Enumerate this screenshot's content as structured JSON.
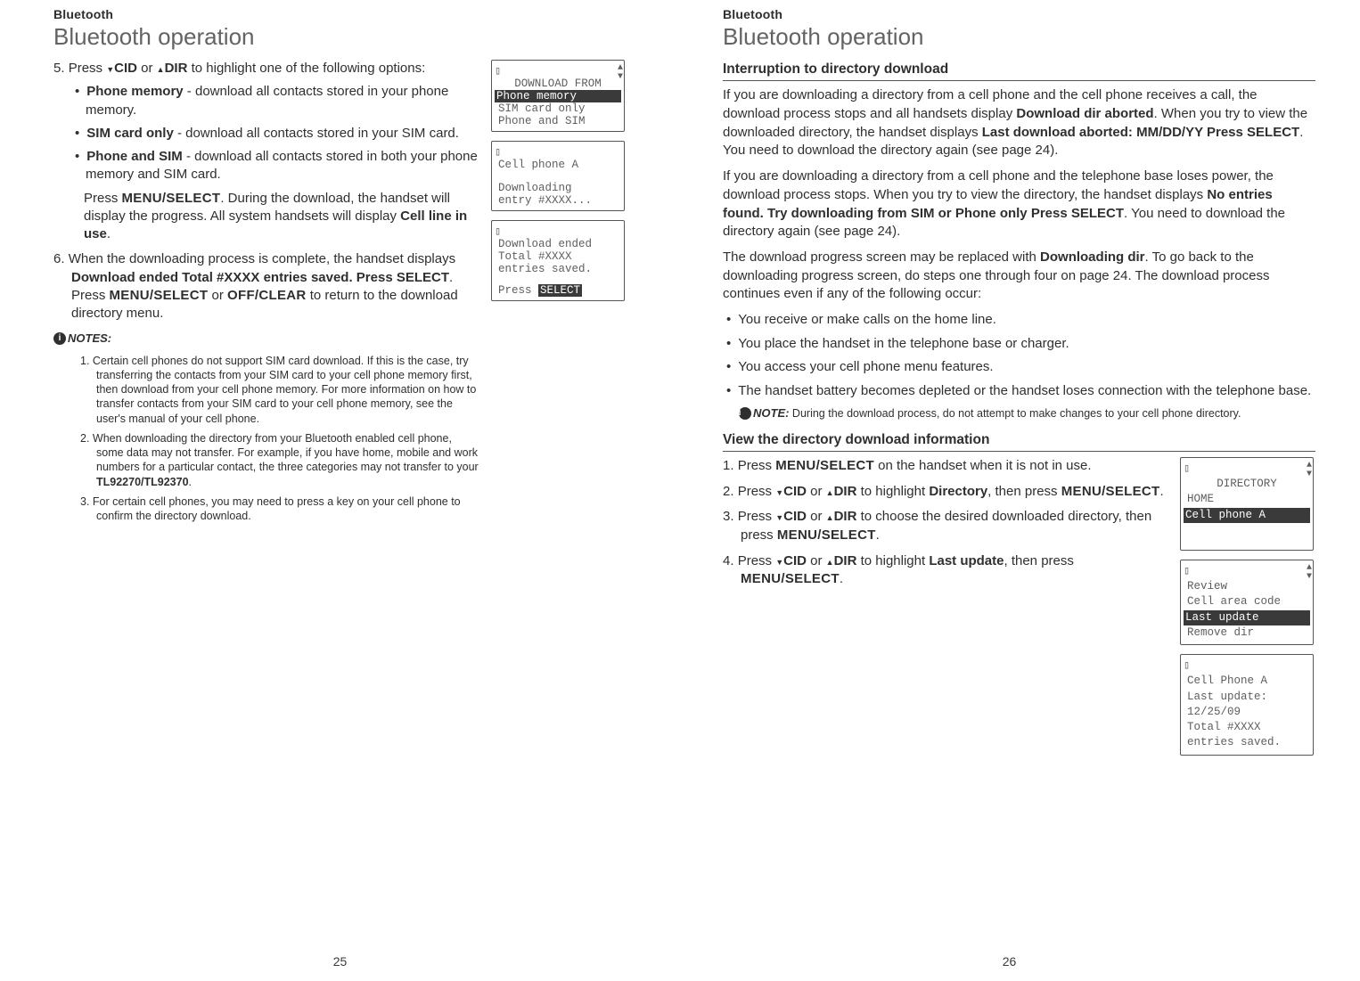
{
  "left": {
    "header": "Bluetooth",
    "title": "Bluetooth operation",
    "step5_intro_a": "Press ",
    "step5_intro_b": " or ",
    "step5_intro_c": " to highlight one of the following options:",
    "cid": "CID",
    "dir": "DIR",
    "opt1_lbl": "Phone memory",
    "opt1_txt": " - download all contacts stored in your phone memory.",
    "opt2_lbl": "SIM card only",
    "opt2_txt": " - download all contacts stored in your SIM card.",
    "opt3_lbl": "Phone and SIM",
    "opt3_txt": " - download all contacts stored in both your phone memory and SIM card.",
    "step5_press1": "Press ",
    "menu_select": "MENU/SELECT",
    "step5_after": ". During the download, the handset will display the progress. All system handsets will display ",
    "cell_line": "Cell line in use",
    "period": ".",
    "step6_a": "When the downloading process is complete, the handset displays ",
    "step6_b": "Download ended Total #XXXX entries saved. Press SELECT",
    "step6_c": ". Press ",
    "step6_or": " or ",
    "off_clear": "OFF/CLEAR",
    "step6_d": " to return to the download directory menu.",
    "notes_label": "NOTES:",
    "note1": "Certain cell phones do not support SIM card download. If this is the case, try transferring the contacts from your SIM card to your cell phone memory first, then download from your cell phone memory. For more information on how to transfer contacts from your SIM card to your cell phone memory, see the user's manual of your cell phone.",
    "note2a": "When downloading the directory from your Bluetooth enabled cell phone, some data may not transfer. For example, if you have home, mobile and work numbers for a particular contact, the three categories may not transfer to your ",
    "note2b": "TL92270/TL92370",
    "note3": "For certain cell phones, you may need to press a key on your cell phone to confirm the directory download.",
    "lcd1": {
      "title": "DOWNLOAD FROM",
      "l1": "Phone memory",
      "l2": "SIM card only",
      "l3": "Phone and SIM"
    },
    "lcd2": {
      "l1": "Cell phone A",
      "l2": "Downloading",
      "l3": "entry #XXXX..."
    },
    "lcd3": {
      "l1": "Download ended",
      "l2": "Total #XXXX",
      "l3": "entries saved.",
      "l4a": "Press ",
      "l4b": "SELECT"
    },
    "page": "25"
  },
  "right": {
    "header": "Bluetooth",
    "title": "Bluetooth operation",
    "sub1": "Interruption to directory download",
    "p1a": "If you are downloading a directory from a cell phone and the cell phone receives a call, the download process stops and all handsets display ",
    "p1b": "Download dir aborted",
    "p1c": ". When you try to view the downloaded directory, the handset displays ",
    "p1d": "Last download aborted: MM/DD/YY Press SELECT",
    "p1e": ". You need to download the directory again (see page 24).",
    "p2a": "If you are downloading a directory from a cell phone and the telephone base loses power, the download process stops. When you try to view the directory, the handset displays ",
    "p2b": "No entries found. Try downloading from SIM or Phone only Press SELECT",
    "p2c": ". You need to download the directory again (see page 24).",
    "p3a": "The download progress screen may be replaced with ",
    "p3b": "Downloading dir",
    "p3c": ". To go back to the downloading progress screen, do steps one through four on page 24. The download process continues even if any of the following occur:",
    "b1": "You receive or make calls on the home line.",
    "b2": "You place the handset in the telephone base or charger.",
    "b3": "You access your cell phone menu features.",
    "b4": "The handset battery becomes depleted or the handset loses connection with the telephone base.",
    "note_lbl": "NOTE:",
    "note_txt": " During the download process, do not attempt to make changes to your cell phone directory.",
    "sub2": "View the directory download information",
    "cid": "CID",
    "dir": "DIR",
    "s1a": "Press ",
    "s1b": " on the handset when it is not in use.",
    "s2a": "Press ",
    "s2b": " or ",
    "s2c": " to highlight ",
    "s2d": "Directory",
    "s2e": ", then press ",
    "s3a": "Press ",
    "s3b": " or ",
    "s3c": " to choose the desired downloaded directory, then press ",
    "s4a": "Press ",
    "s4b": " or ",
    "s4c": " to highlight ",
    "s4d": "Last update",
    "s4e": ", then press ",
    "menu_select": "MENU/SELECT",
    "period": ".",
    "lcd1": {
      "title": "DIRECTORY",
      "l1": "HOME",
      "l2": "Cell phone A"
    },
    "lcd2": {
      "l1": "Review",
      "l2": "Cell area code",
      "l3": "Last update",
      "l4": "Remove dir"
    },
    "lcd3": {
      "l1": "Cell Phone A",
      "l2": "Last update:",
      "l3": "12/25/09",
      "l4": "Total #XXXX",
      "l5": "entries saved."
    },
    "page": "26"
  }
}
